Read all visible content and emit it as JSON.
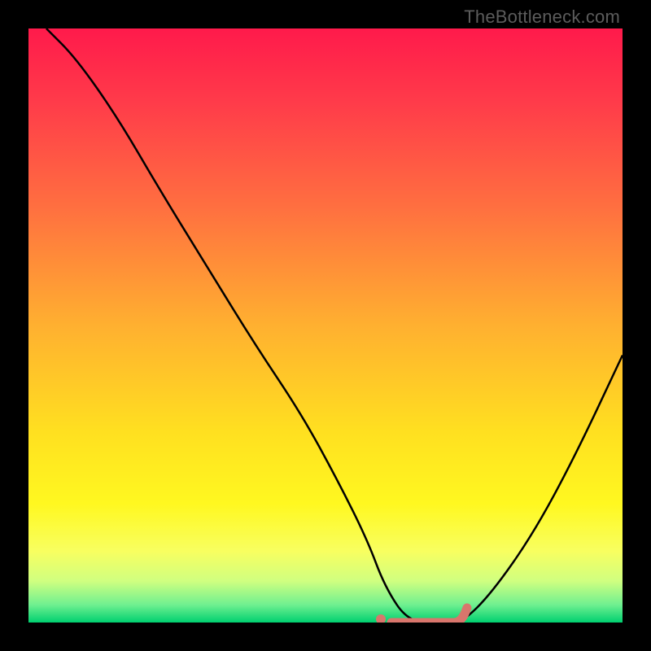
{
  "watermark": "TheBottleneck.com",
  "chart_data": {
    "type": "line",
    "title": "",
    "xlabel": "",
    "ylabel": "",
    "xlim": [
      0,
      100
    ],
    "ylim": [
      0,
      100
    ],
    "series": [
      {
        "name": "bottleneck-curve",
        "x": [
          3,
          8,
          15,
          22,
          30,
          38,
          46,
          52,
          57,
          60,
          64,
          70,
          73,
          78,
          85,
          92,
          100
        ],
        "values": [
          100,
          95,
          85,
          73,
          60,
          47,
          35,
          24,
          14,
          6,
          0,
          0,
          0,
          5,
          15,
          28,
          45
        ]
      }
    ],
    "optimal_marker": {
      "start_x": 60,
      "end_x": 73,
      "y": 0
    },
    "gradient_stops": [
      {
        "offset": 0.0,
        "color": "#ff1a4b"
      },
      {
        "offset": 0.12,
        "color": "#ff3a4a"
      },
      {
        "offset": 0.3,
        "color": "#ff6f40"
      },
      {
        "offset": 0.5,
        "color": "#ffb030"
      },
      {
        "offset": 0.68,
        "color": "#ffe020"
      },
      {
        "offset": 0.8,
        "color": "#fff820"
      },
      {
        "offset": 0.88,
        "color": "#f8ff60"
      },
      {
        "offset": 0.93,
        "color": "#d0ff80"
      },
      {
        "offset": 0.97,
        "color": "#70f090"
      },
      {
        "offset": 1.0,
        "color": "#00d070"
      }
    ]
  }
}
